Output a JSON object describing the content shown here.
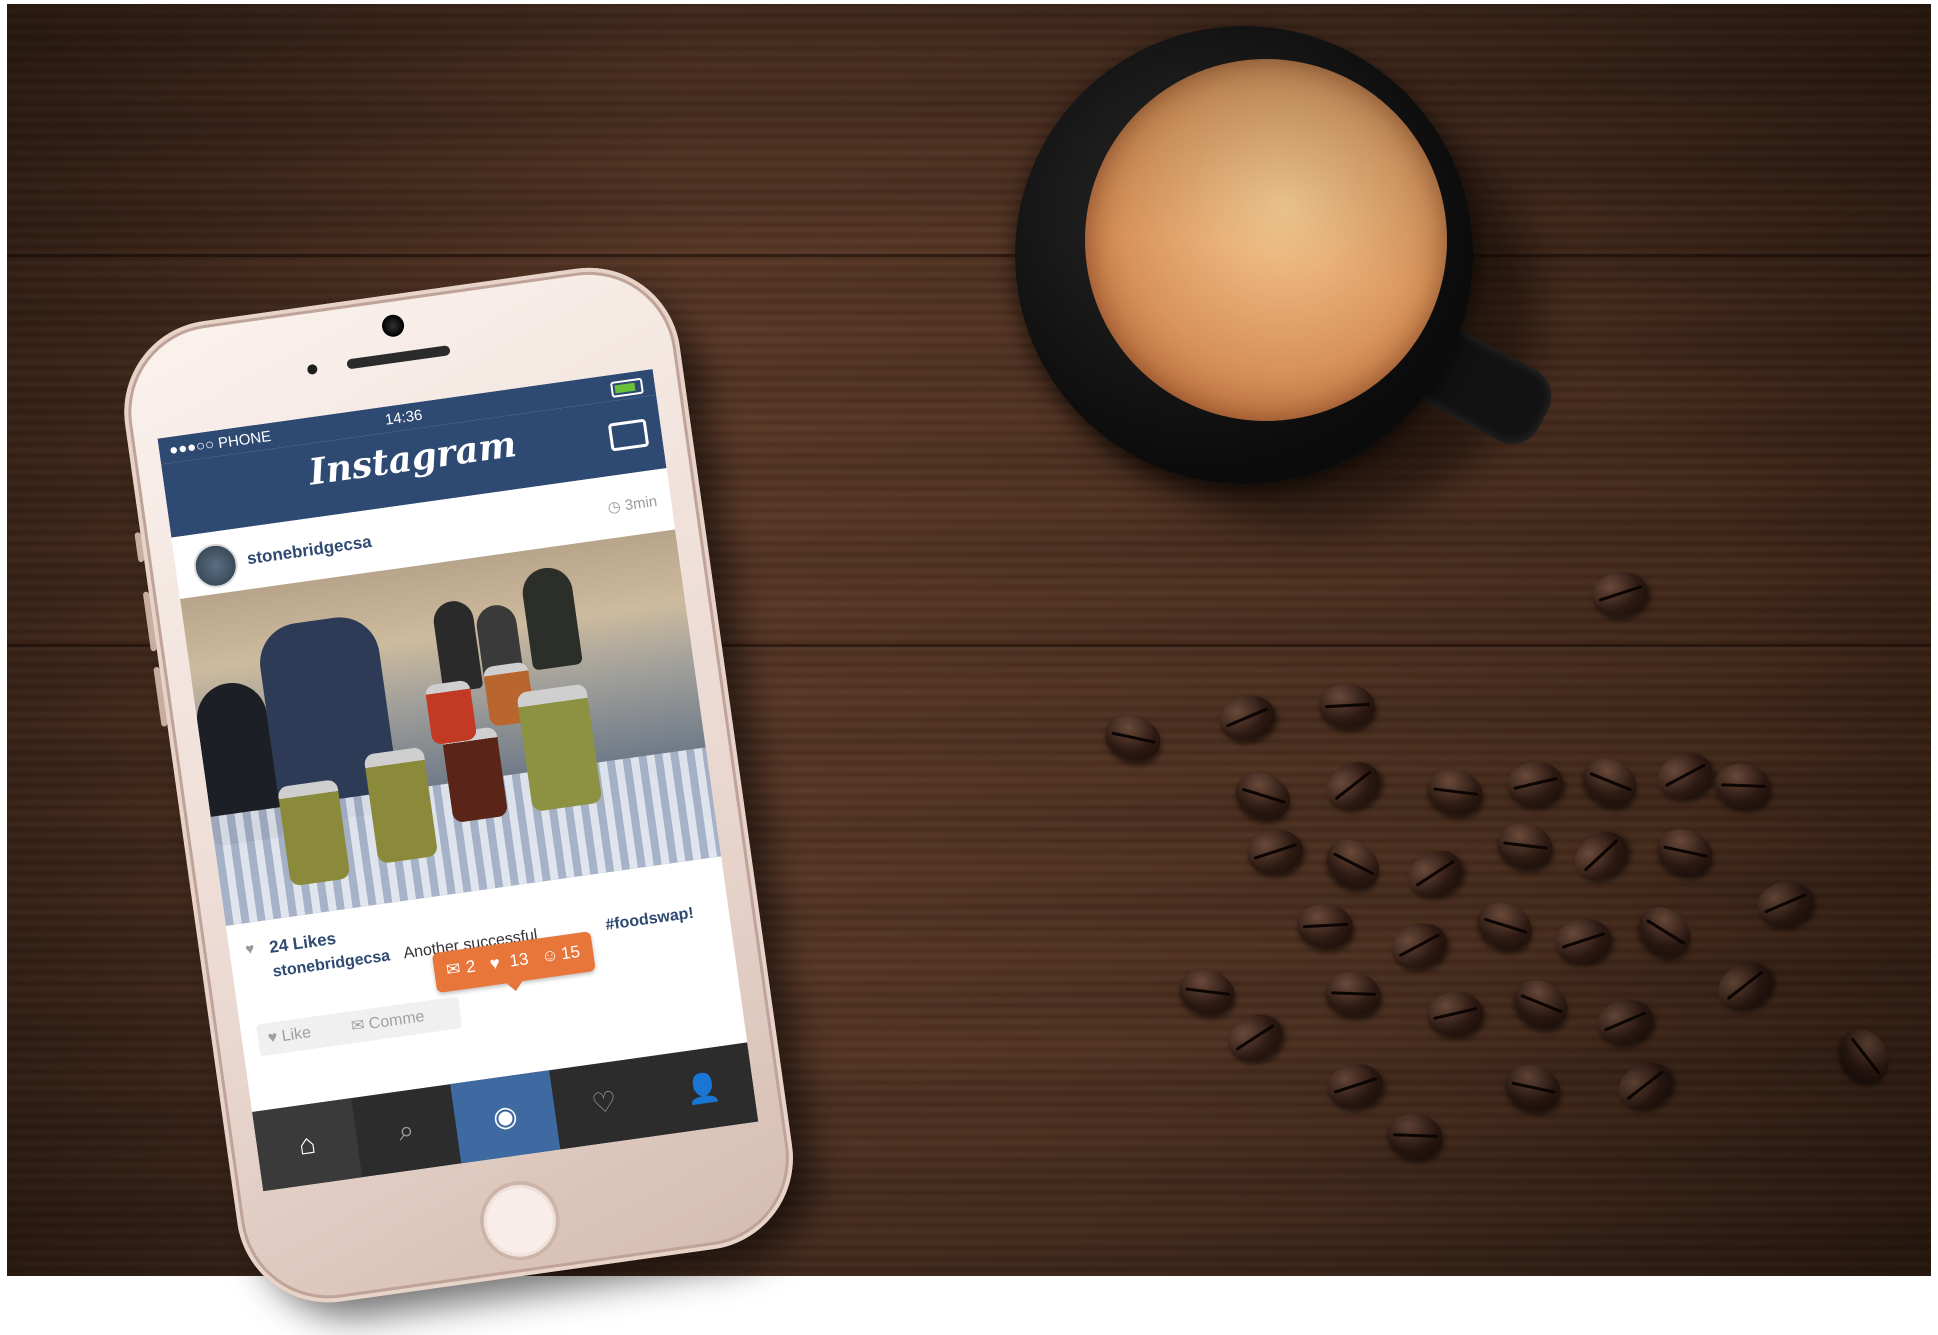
{
  "phone": {
    "status_bar": {
      "carrier": "●●●○○ PHONE",
      "time": "14:36"
    },
    "header": {
      "app_title": "Instagram"
    },
    "post": {
      "username": "stonebridgecsa",
      "timestamp": "3min",
      "likes": "24 Likes",
      "caption_user": "stonebridgecsa",
      "caption_text": "Another successful",
      "caption_hashtag": "#foodswap!",
      "like_label": "Like",
      "comment_label": "Comme"
    },
    "notifications": {
      "comments": "2",
      "likes": "13",
      "followers": "15"
    },
    "tab_bar": {
      "home_icon": "⌂",
      "search_icon": "⌕",
      "camera_icon": "◉",
      "activity_icon": "♡",
      "profile_icon": "👤"
    }
  },
  "colors": {
    "ig_blue": "#2f4a72",
    "badge_orange": "#e8763a",
    "table_wood": "#4f3222",
    "crema": "#d8945a"
  }
}
